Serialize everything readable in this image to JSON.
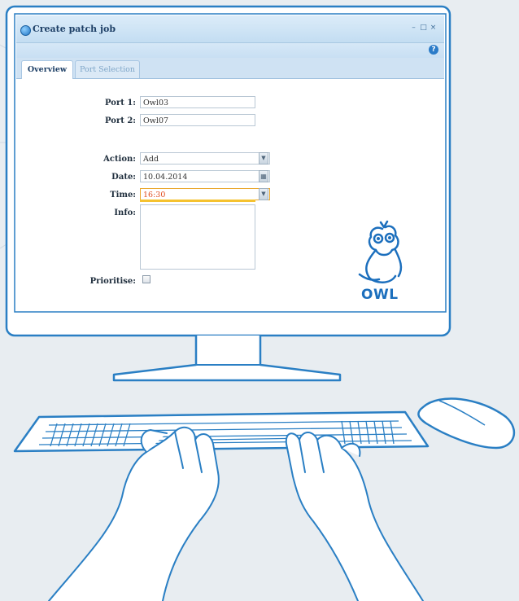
{
  "window": {
    "title": "Create patch job",
    "controls": [
      "minimize",
      "maximize",
      "close"
    ],
    "help_icon": "question-icon"
  },
  "tabs": [
    {
      "label": "Overview",
      "active": true
    },
    {
      "label": "Port Selection",
      "active": false
    }
  ],
  "form": {
    "port1": {
      "label": "Port 1:",
      "value": "Owl03"
    },
    "port2": {
      "label": "Port 2:",
      "value": "Owl07"
    },
    "action": {
      "label": "Action:",
      "value": "Add"
    },
    "date": {
      "label": "Date:",
      "value": "10.04.2014"
    },
    "time": {
      "label": "Time:",
      "value": "16:30"
    },
    "info": {
      "label": "Info:",
      "value": ""
    },
    "prioritise": {
      "label": "Prioritise:",
      "checked": false
    }
  },
  "logo": {
    "text": "OWL"
  },
  "colors": {
    "accent": "#1c6fbd",
    "outline": "#2a7fc4",
    "time_highlight": "#e04b1e",
    "background": "#e8edf1"
  }
}
